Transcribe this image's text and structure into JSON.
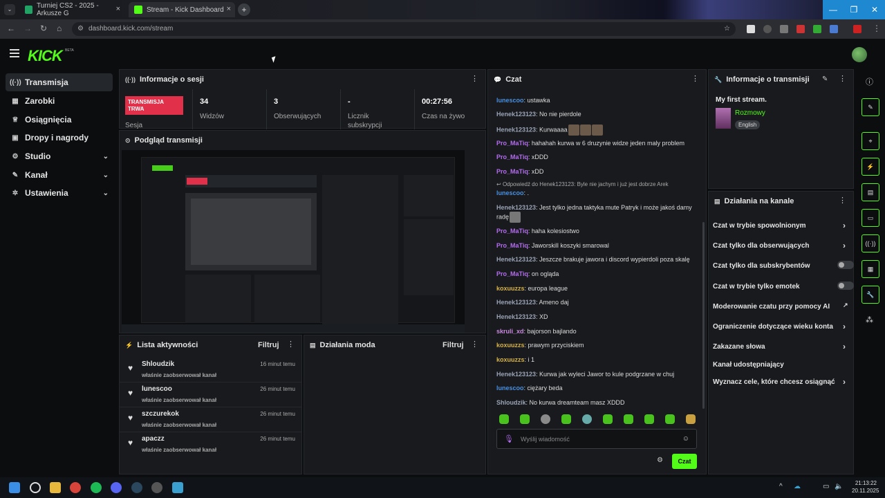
{
  "browser": {
    "tabs": [
      {
        "label": "Turniej CS2 - 2025 - Arkusze G"
      },
      {
        "label": "Stream - Kick Dashboard"
      }
    ],
    "url": "dashboard.kick.com/stream"
  },
  "brand": {
    "logo": "KICK",
    "beta": "BETA",
    "accent": "#53fc18"
  },
  "sidebar": {
    "items": [
      {
        "label": "Transmisja",
        "icon": "broadcast-icon"
      },
      {
        "label": "Zarobki",
        "icon": "wallet-icon"
      },
      {
        "label": "Osiągnięcia",
        "icon": "trophy-icon"
      },
      {
        "label": "Dropy i nagrody",
        "icon": "gift-icon"
      },
      {
        "label": "Studio",
        "icon": "studio-icon"
      },
      {
        "label": "Kanał",
        "icon": "channel-icon"
      },
      {
        "label": "Ustawienia",
        "icon": "gear-icon"
      }
    ]
  },
  "session": {
    "title": "Informacje o sesji",
    "live_badge": "TRANSMISJA TRWA",
    "session_label": "Sesja",
    "stats": [
      {
        "value": "34",
        "label": "Widzów"
      },
      {
        "value": "3",
        "label": "Obserwujących"
      },
      {
        "value": "-",
        "label": "Licznik subskrypcji"
      },
      {
        "value": "00:27:56",
        "label": "Czas na żywo"
      }
    ]
  },
  "preview": {
    "title": "Podgląd transmisji"
  },
  "activity": {
    "title": "Lista aktywności",
    "filter": "Filtruj",
    "items": [
      {
        "name": "Shloudzik",
        "sub": "właśnie zaobserwował kanał",
        "time": "16 minut temu"
      },
      {
        "name": "lunescoo",
        "sub": "właśnie zaobserwował kanał",
        "time": "26 minut temu"
      },
      {
        "name": "szczurekok",
        "sub": "właśnie zaobserwował kanał",
        "time": "26 minut temu"
      },
      {
        "name": "apaczz",
        "sub": "właśnie zaobserwował kanał",
        "time": "26 minut temu"
      }
    ]
  },
  "mod": {
    "title": "Działania moda",
    "filter": "Filtruj"
  },
  "chat": {
    "title": "Czat",
    "messages": [
      {
        "user": "lunescoo",
        "text": ": ustawka",
        "color": "#4a90e2"
      },
      {
        "user": "Henek123123",
        "text": ": No nie pierdole",
        "color": "#9aa3b5"
      },
      {
        "user": "Henek123123",
        "text": ": Kurwaaaa",
        "color": "#9aa3b5"
      },
      {
        "user": "Pro_MaTiq",
        "text": ": hahahah kurwa w 6 druzynie widze jeden maly problem",
        "color": "#b46cf0"
      },
      {
        "user": "Pro_MaTiq",
        "text": ": xDDD",
        "color": "#b46cf0"
      },
      {
        "user": "Pro_MaTiq",
        "text": ": xDD",
        "color": "#b46cf0"
      },
      {
        "user": "Henek123123",
        "text": ": Jest tylko jedna taktyka mute Patryk i może jakoś damy radę",
        "color": "#9aa3b5"
      },
      {
        "user": "Pro_MaTiq",
        "text": ": haha kolesiostwo",
        "color": "#b46cf0"
      },
      {
        "user": "Pro_MaTiq",
        "text": ": Jaworskill koszyki smarowal",
        "color": "#b46cf0"
      },
      {
        "user": "Henek123123",
        "text": ": Jeszcze brakuje jawora i discord wypierdoli poza skalę",
        "color": "#9aa3b5"
      },
      {
        "user": "Pro_MaTiq",
        "text": ": on ogląda",
        "color": "#b46cf0"
      },
      {
        "user": "koxuuzzs",
        "text": ": europa league",
        "color": "#d6b24a"
      },
      {
        "user": "Henek123123",
        "text": ": Ameno daj",
        "color": "#9aa3b5"
      },
      {
        "user": "Henek123123",
        "text": ": XD",
        "color": "#9aa3b5"
      },
      {
        "user": "skruli_xd",
        "text": ": bajorson bajlando",
        "color": "#c98adf"
      },
      {
        "user": "koxuuzzs",
        "text": ": prawym przyciskiem",
        "color": "#d6b24a"
      },
      {
        "user": "koxuuzzs",
        "text": ": i 1",
        "color": "#d6b24a"
      },
      {
        "user": "Henek123123",
        "text": ": Kurwa jak wyleci Jawor to kule podgrzane w chuj",
        "color": "#9aa3b5"
      },
      {
        "user": "lunescoo",
        "text": ": ciężary beda",
        "color": "#4a90e2"
      },
      {
        "user": "Shloudzik",
        "text": ": No kurwa dreamteam masz XDDD",
        "color": "#9aa3b5"
      }
    ],
    "reply_label": "Odpowiedź do Henek123123: Byle nie jachym i już jest dobrze Arek",
    "reply_user": "lunescoo",
    "reply_text": ": .",
    "input_placeholder": "Wyślij wiadomość",
    "send_label": "Czat"
  },
  "stream_info": {
    "title": "Informacje o transmisji",
    "stream_title": "My first stream.",
    "category": "Rozmowy",
    "language": "English"
  },
  "channel_actions": {
    "title": "Działania na kanale",
    "items": [
      {
        "label": "Czat w trybie spowolnionym",
        "control": "arrow"
      },
      {
        "label": "Czat tylko dla obserwujących",
        "control": "arrow"
      },
      {
        "label": "Czat tylko dla subskrybentów",
        "control": "toggle"
      },
      {
        "label": "Czat w trybie tylko emotek",
        "control": "toggle"
      },
      {
        "label": "Moderowanie czatu przy pomocy AI",
        "control": "external"
      },
      {
        "label": "Ograniczenie dotyczące wieku konta",
        "control": "arrow"
      },
      {
        "label": "Zakazane słowa",
        "control": "arrow"
      },
      {
        "label": "Kanał udostępniający",
        "control": "none"
      },
      {
        "label": "Wyznacz cele, które chcesz osiągnąć",
        "control": "arrow"
      }
    ]
  },
  "taskbar": {
    "time": "21:13:22",
    "date": "20.11.2025"
  }
}
